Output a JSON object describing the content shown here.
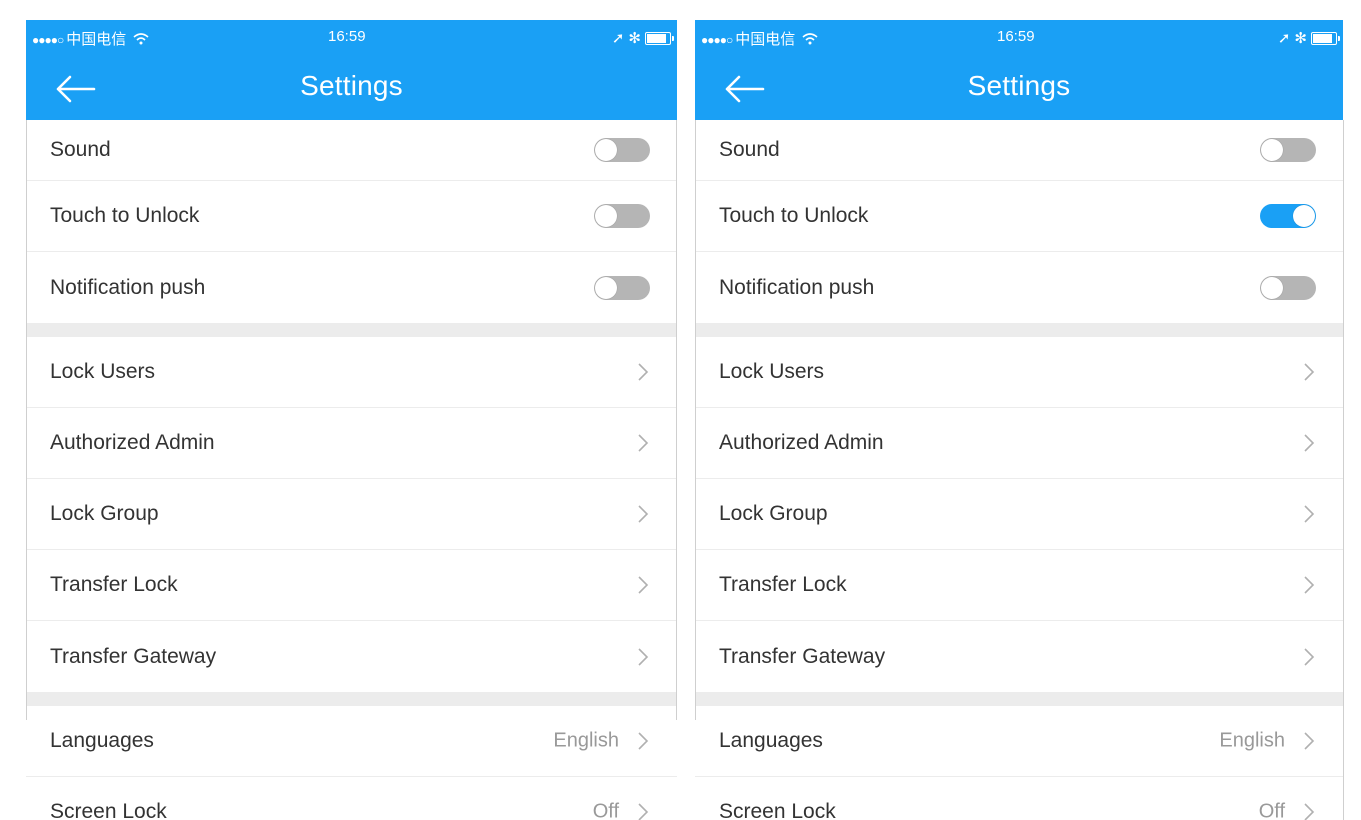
{
  "status_bar": {
    "signal_dots": "●●●●○",
    "carrier": "中国电信",
    "wifi_icon": "wifi-icon",
    "time": "16:59",
    "location_icon": "➚",
    "bluetooth_icon": "✻"
  },
  "nav": {
    "title": "Settings",
    "back_icon": "arrow-left-icon"
  },
  "colors": {
    "accent": "#1aa0f5",
    "toggle_off": "#b5b5b5",
    "separator": "#ececec",
    "label": "#333333",
    "value": "#999999"
  },
  "screens": [
    {
      "toggles": [
        {
          "label": "Sound",
          "on": false
        },
        {
          "label": "Touch to Unlock",
          "on": false
        },
        {
          "label": "Notification push",
          "on": false
        }
      ],
      "nav_rows": [
        "Lock Users",
        "Authorized Admin",
        "Lock Group",
        "Transfer Lock",
        "Transfer Gateway"
      ],
      "value_rows": [
        {
          "label": "Languages",
          "value": "English"
        },
        {
          "label": "Screen Lock",
          "value": "Off"
        }
      ]
    },
    {
      "toggles": [
        {
          "label": "Sound",
          "on": false
        },
        {
          "label": "Touch to Unlock",
          "on": true
        },
        {
          "label": "Notification push",
          "on": false
        }
      ],
      "nav_rows": [
        "Lock Users",
        "Authorized Admin",
        "Lock Group",
        "Transfer Lock",
        "Transfer Gateway"
      ],
      "value_rows": [
        {
          "label": "Languages",
          "value": "English"
        },
        {
          "label": "Screen Lock",
          "value": "Off"
        }
      ]
    }
  ]
}
